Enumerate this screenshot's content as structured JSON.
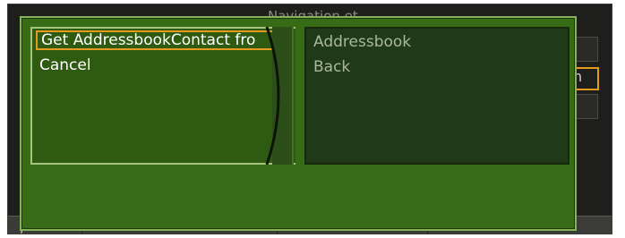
{
  "background_window": {
    "title": "Navigation et",
    "focused_slot_text": "n",
    "bottom_left_glyph": "/"
  },
  "popup": {
    "left_pane": {
      "items": [
        {
          "label": "Get AddressbookContact fro",
          "selected": true
        },
        {
          "label": "Cancel",
          "selected": false
        }
      ]
    },
    "right_pane": {
      "items": [
        {
          "label": "Addressbook"
        },
        {
          "label": "Back"
        }
      ]
    }
  },
  "colors": {
    "popup_bg": "#376b16",
    "selection_outline": "#e39a1e",
    "window_bg": "#1e1f1c"
  }
}
